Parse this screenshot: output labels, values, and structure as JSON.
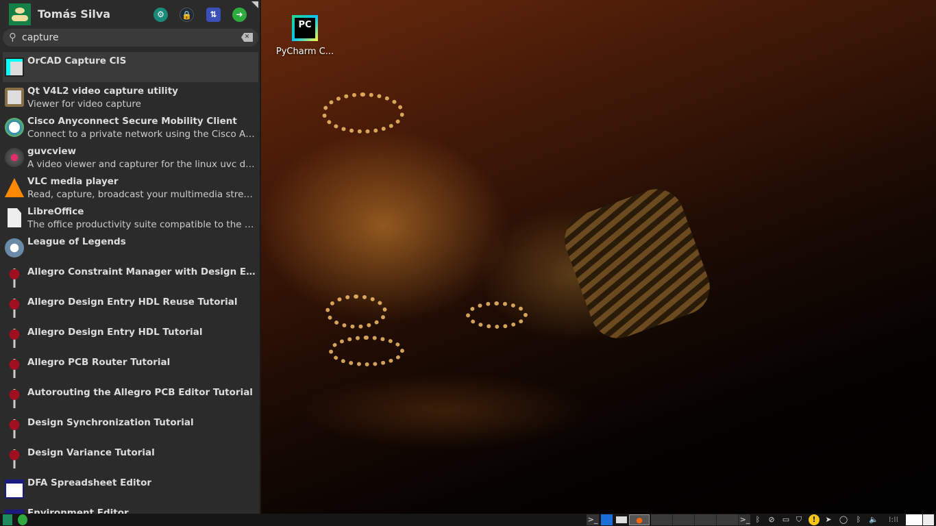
{
  "user": {
    "name": "Tomás Silva"
  },
  "header_buttons": [
    {
      "name": "settings"
    },
    {
      "name": "lock"
    },
    {
      "name": "switch-user"
    },
    {
      "name": "logout"
    }
  ],
  "search": {
    "value": "capture"
  },
  "desktop": {
    "icons": [
      {
        "label": "PyCharm C..."
      }
    ]
  },
  "results": [
    {
      "title": "OrCAD Capture CIS",
      "desc": "",
      "icon": "orcad-icon"
    },
    {
      "title": "Qt V4L2 video capture utility",
      "desc": "Viewer for video capture",
      "icon": "qv4l2-icon"
    },
    {
      "title": "Cisco Anyconnect Secure Mobility Client",
      "desc": "Connect to a private network using the Cisco Anyconnect...",
      "icon": "cisco-icon"
    },
    {
      "title": "guvcview",
      "desc": "A video viewer and capturer for the linux uvc driver",
      "icon": "guvcview-icon"
    },
    {
      "title": "VLC media player",
      "desc": "Read, capture, broadcast your multimedia streams",
      "icon": "vlc-icon"
    },
    {
      "title": "LibreOffice",
      "desc": "The office productivity suite compatible to the open and...",
      "icon": "document-icon"
    },
    {
      "title": "League of Legends",
      "desc": "",
      "icon": "gear-icon"
    },
    {
      "title": "Allegro Constraint Manager with Design Entry HDL",
      "desc": "",
      "icon": "wine-icon"
    },
    {
      "title": "Allegro Design Entry HDL Reuse Tutorial",
      "desc": "",
      "icon": "wine-icon"
    },
    {
      "title": "Allegro Design Entry HDL Tutorial",
      "desc": "",
      "icon": "wine-icon"
    },
    {
      "title": "Allegro PCB Router Tutorial",
      "desc": "",
      "icon": "wine-icon"
    },
    {
      "title": "Autorouting the Allegro PCB Editor Tutorial",
      "desc": "",
      "icon": "wine-icon"
    },
    {
      "title": "Design Synchronization Tutorial",
      "desc": "",
      "icon": "wine-icon"
    },
    {
      "title": "Design Variance Tutorial",
      "desc": "",
      "icon": "wine-icon"
    },
    {
      "title": "DFA Spreadsheet Editor",
      "desc": "",
      "icon": "dfa-icon"
    },
    {
      "title": "Environment Editor",
      "desc": "",
      "icon": "dfa-icon"
    }
  ],
  "taskbar": {
    "terminal": ">_",
    "tray_terminal": ">_",
    "notice": "!"
  }
}
